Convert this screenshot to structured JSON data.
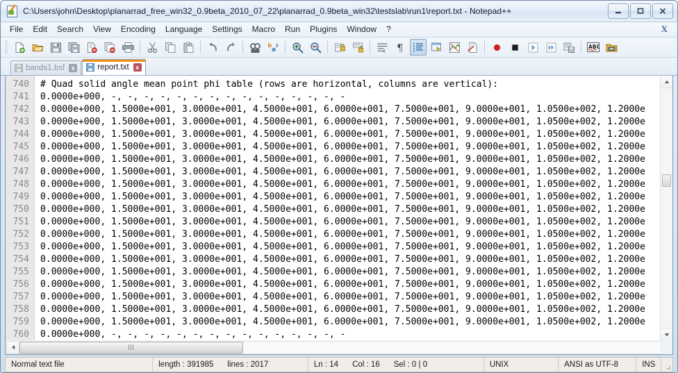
{
  "window": {
    "title": "C:\\Users\\john\\Desktop\\planarrad_free_win32_0.9beta_2010_07_22\\planarrad_0.9beta_win32\\testslab\\run1\\report.txt - Notepad++",
    "app_icon": "notepad-plus-plus-icon",
    "controls": {
      "minimize": "Minimize",
      "maximize": "Restore",
      "close": "Close"
    }
  },
  "menubar": {
    "items": [
      {
        "label": "File"
      },
      {
        "label": "Edit"
      },
      {
        "label": "Search"
      },
      {
        "label": "View"
      },
      {
        "label": "Encoding"
      },
      {
        "label": "Language"
      },
      {
        "label": "Settings"
      },
      {
        "label": "Macro"
      },
      {
        "label": "Run"
      },
      {
        "label": "Plugins"
      },
      {
        "label": "Window"
      },
      {
        "label": "?"
      }
    ],
    "close_document": "X"
  },
  "toolbar": {
    "buttons": [
      {
        "name": "new-file-icon"
      },
      {
        "name": "open-file-icon"
      },
      {
        "name": "save-icon"
      },
      {
        "name": "save-all-icon"
      },
      {
        "name": "close-file-icon"
      },
      {
        "name": "close-all-files-icon"
      },
      {
        "name": "print-icon"
      },
      {
        "separator": true
      },
      {
        "name": "cut-icon"
      },
      {
        "name": "copy-icon"
      },
      {
        "name": "paste-icon"
      },
      {
        "separator": true
      },
      {
        "name": "undo-icon"
      },
      {
        "name": "redo-icon"
      },
      {
        "separator": true
      },
      {
        "name": "find-icon"
      },
      {
        "name": "replace-icon"
      },
      {
        "separator": true
      },
      {
        "name": "zoom-in-icon"
      },
      {
        "name": "zoom-out-icon"
      },
      {
        "separator": true
      },
      {
        "name": "sync-vertical-scroll-icon"
      },
      {
        "name": "sync-horizontal-scroll-icon"
      },
      {
        "separator": true
      },
      {
        "name": "word-wrap-icon"
      },
      {
        "name": "show-all-characters-icon"
      },
      {
        "name": "indent-guide-icon",
        "pressed": true
      },
      {
        "name": "user-defined-dialog-icon"
      },
      {
        "name": "document-map-icon"
      },
      {
        "name": "function-list-icon"
      },
      {
        "separator": true
      },
      {
        "name": "macro-record-icon"
      },
      {
        "name": "macro-stop-icon"
      },
      {
        "name": "macro-play-icon"
      },
      {
        "name": "macro-play-multiple-icon"
      },
      {
        "name": "macro-save-icon"
      },
      {
        "separator": true
      },
      {
        "name": "spell-check-icon"
      },
      {
        "name": "folder-as-workspace-icon"
      }
    ]
  },
  "tabs": [
    {
      "label": "bands1.bsf",
      "active": false,
      "icon": "saved-file-icon",
      "close": "x"
    },
    {
      "label": "report.txt",
      "active": true,
      "icon": "saved-file-icon",
      "close": "x"
    }
  ],
  "editor": {
    "first_line_number": 740,
    "lines": [
      {
        "number": "740",
        "text": "# Quad solid angle mean point phi table (rows are horizontal, columns are vertical):"
      },
      {
        "number": "741",
        "text": "0.0000e+000, -, -, -, -, -, -, -, -, -, -, -, -, -, -, -"
      },
      {
        "number": "742",
        "text": "0.0000e+000, 1.5000e+001, 3.0000e+001, 4.5000e+001, 6.0000e+001, 7.5000e+001, 9.0000e+001, 1.0500e+002, 1.2000e"
      },
      {
        "number": "743",
        "text": "0.0000e+000, 1.5000e+001, 3.0000e+001, 4.5000e+001, 6.0000e+001, 7.5000e+001, 9.0000e+001, 1.0500e+002, 1.2000e"
      },
      {
        "number": "744",
        "text": "0.0000e+000, 1.5000e+001, 3.0000e+001, 4.5000e+001, 6.0000e+001, 7.5000e+001, 9.0000e+001, 1.0500e+002, 1.2000e"
      },
      {
        "number": "745",
        "text": "0.0000e+000, 1.5000e+001, 3.0000e+001, 4.5000e+001, 6.0000e+001, 7.5000e+001, 9.0000e+001, 1.0500e+002, 1.2000e"
      },
      {
        "number": "746",
        "text": "0.0000e+000, 1.5000e+001, 3.0000e+001, 4.5000e+001, 6.0000e+001, 7.5000e+001, 9.0000e+001, 1.0500e+002, 1.2000e"
      },
      {
        "number": "747",
        "text": "0.0000e+000, 1.5000e+001, 3.0000e+001, 4.5000e+001, 6.0000e+001, 7.5000e+001, 9.0000e+001, 1.0500e+002, 1.2000e"
      },
      {
        "number": "748",
        "text": "0.0000e+000, 1.5000e+001, 3.0000e+001, 4.5000e+001, 6.0000e+001, 7.5000e+001, 9.0000e+001, 1.0500e+002, 1.2000e"
      },
      {
        "number": "749",
        "text": "0.0000e+000, 1.5000e+001, 3.0000e+001, 4.5000e+001, 6.0000e+001, 7.5000e+001, 9.0000e+001, 1.0500e+002, 1.2000e"
      },
      {
        "number": "750",
        "text": "0.0000e+000, 1.5000e+001, 3.0000e+001, 4.5000e+001, 6.0000e+001, 7.5000e+001, 9.0000e+001, 1.0500e+002, 1.2000e"
      },
      {
        "number": "751",
        "text": "0.0000e+000, 1.5000e+001, 3.0000e+001, 4.5000e+001, 6.0000e+001, 7.5000e+001, 9.0000e+001, 1.0500e+002, 1.2000e"
      },
      {
        "number": "752",
        "text": "0.0000e+000, 1.5000e+001, 3.0000e+001, 4.5000e+001, 6.0000e+001, 7.5000e+001, 9.0000e+001, 1.0500e+002, 1.2000e"
      },
      {
        "number": "753",
        "text": "0.0000e+000, 1.5000e+001, 3.0000e+001, 4.5000e+001, 6.0000e+001, 7.5000e+001, 9.0000e+001, 1.0500e+002, 1.2000e"
      },
      {
        "number": "754",
        "text": "0.0000e+000, 1.5000e+001, 3.0000e+001, 4.5000e+001, 6.0000e+001, 7.5000e+001, 9.0000e+001, 1.0500e+002, 1.2000e"
      },
      {
        "number": "755",
        "text": "0.0000e+000, 1.5000e+001, 3.0000e+001, 4.5000e+001, 6.0000e+001, 7.5000e+001, 9.0000e+001, 1.0500e+002, 1.2000e"
      },
      {
        "number": "756",
        "text": "0.0000e+000, 1.5000e+001, 3.0000e+001, 4.5000e+001, 6.0000e+001, 7.5000e+001, 9.0000e+001, 1.0500e+002, 1.2000e"
      },
      {
        "number": "757",
        "text": "0.0000e+000, 1.5000e+001, 3.0000e+001, 4.5000e+001, 6.0000e+001, 7.5000e+001, 9.0000e+001, 1.0500e+002, 1.2000e"
      },
      {
        "number": "758",
        "text": "0.0000e+000, 1.5000e+001, 3.0000e+001, 4.5000e+001, 6.0000e+001, 7.5000e+001, 9.0000e+001, 1.0500e+002, 1.2000e"
      },
      {
        "number": "759",
        "text": "0.0000e+000, 1.5000e+001, 3.0000e+001, 4.5000e+001, 6.0000e+001, 7.5000e+001, 9.0000e+001, 1.0500e+002, 1.2000e"
      },
      {
        "number": "760",
        "text": "0.0000e+000, -, -, -, -, -, -, -, -, -, -, -, -, -, -, -"
      }
    ]
  },
  "statusbar": {
    "file_type": "Normal text file",
    "length_label": "length : 391985",
    "lines_label": "lines : 2017",
    "ln": "Ln : 14",
    "col": "Col : 16",
    "sel": "Sel : 0 | 0",
    "eol": "UNIX",
    "encoding": "ANSI as UTF-8",
    "insert_mode": "INS"
  },
  "colors": {
    "tab_active_accent": "#f29016",
    "titlebar_text": "#0d1c2c",
    "gutter_bg": "#e8e8e8",
    "gutter_text": "#8a8a8a",
    "editor_text": "#000000",
    "editor_bg": "#ffffff"
  }
}
